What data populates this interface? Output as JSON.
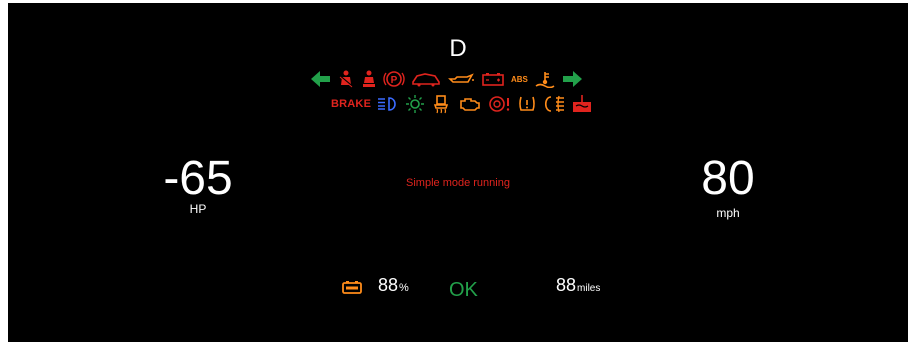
{
  "dashboard": {
    "gear": "D",
    "brake_text": "BRAKE",
    "abs_text": "ABS",
    "power": {
      "value": "-65",
      "unit": "HP"
    },
    "speed": {
      "value": "80",
      "unit": "mph"
    },
    "mode_message": "Simple mode running",
    "battery": {
      "value": "88",
      "unit": "%"
    },
    "status": "OK",
    "range": {
      "value": "88",
      "unit": "miles"
    }
  },
  "colors": {
    "background": "#000000",
    "red": "#e0241e",
    "orange": "#ff8c1a",
    "green": "#22a04a",
    "blue": "#3b6bff",
    "white": "#ffffff"
  },
  "icons": [
    "turn-left-arrow-icon",
    "seatbelt-icon",
    "airbag-icon",
    "parking-brake-icon",
    "hood-open-icon",
    "oil-pressure-icon",
    "battery-warning-icon",
    "abs-icon",
    "coolant-temp-icon",
    "turn-right-arrow-icon",
    "brake-text-icon",
    "high-beam-icon",
    "exterior-light-icon",
    "seat-heater-icon",
    "check-engine-icon",
    "brake-system-icon",
    "tire-pressure-icon",
    "fog-light-icon",
    "coolant-level-icon"
  ]
}
